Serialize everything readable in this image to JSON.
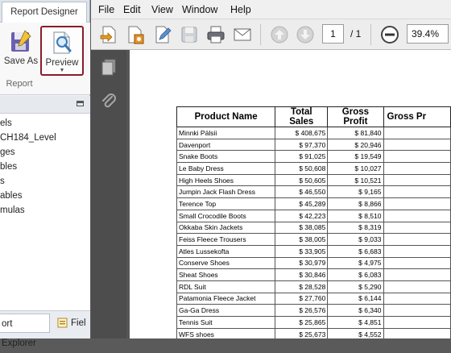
{
  "designer": {
    "tab_title": "Report Designer",
    "save_as_label": "Save As",
    "preview_label": "Preview",
    "group_label": "Report",
    "tree_items": [
      "els",
      "CH184_Level",
      "ges",
      "bles",
      "s",
      "ables",
      "mulas"
    ],
    "bottom_tab_explorer": "ort Explorer",
    "bottom_tab_fields": "Fiel"
  },
  "viewer": {
    "menus": [
      "File",
      "Edit",
      "View",
      "Window",
      "Help"
    ],
    "page_current": "1",
    "page_separator": "/ 1",
    "zoom": "39.4%"
  },
  "report": {
    "headers": [
      "Product Name",
      "Total Sales",
      "Gross Profit",
      "Gross Pr"
    ],
    "rows": [
      [
        "Minnki Pälsii",
        "$ 408,675",
        "$ 81,840"
      ],
      [
        "Davenport",
        "$ 97,370",
        "$ 20,946"
      ],
      [
        "Snake Boots",
        "$ 91,025",
        "$ 19,549"
      ],
      [
        "Le Baby Dress",
        "$ 50,608",
        "$ 10,027"
      ],
      [
        "High Heels Shoes",
        "$ 50,605",
        "$ 10,521"
      ],
      [
        "Jumpin Jack Flash Dress",
        "$ 46,550",
        "$ 9,165"
      ],
      [
        "Terence Top",
        "$ 45,289",
        "$ 8,866"
      ],
      [
        "Small Crocodile Boots",
        "$ 42,223",
        "$ 8,510"
      ],
      [
        "Okkaba Skin Jackets",
        "$ 38,085",
        "$ 8,319"
      ],
      [
        "Feiss Fleece Trousers",
        "$ 38,005",
        "$ 9,033"
      ],
      [
        "Atles Lussekofta",
        "$ 33,905",
        "$ 6,683"
      ],
      [
        "Conserve Shoes",
        "$ 30,979",
        "$ 4,975"
      ],
      [
        "Sheat Shoes",
        "$ 30,846",
        "$ 6,083"
      ],
      [
        "RDL Suit",
        "$ 28,528",
        "$ 5,290"
      ],
      [
        "Patamonia Fleece Jacket",
        "$ 27,760",
        "$ 6,144"
      ],
      [
        "Ga-Ga Dress",
        "$ 26,576",
        "$ 6,340"
      ],
      [
        "Tennis Suit",
        "$ 25,865",
        "$ 4,851"
      ],
      [
        "WFS shoes",
        "$ 25,673",
        "$ 4,552"
      ]
    ]
  }
}
